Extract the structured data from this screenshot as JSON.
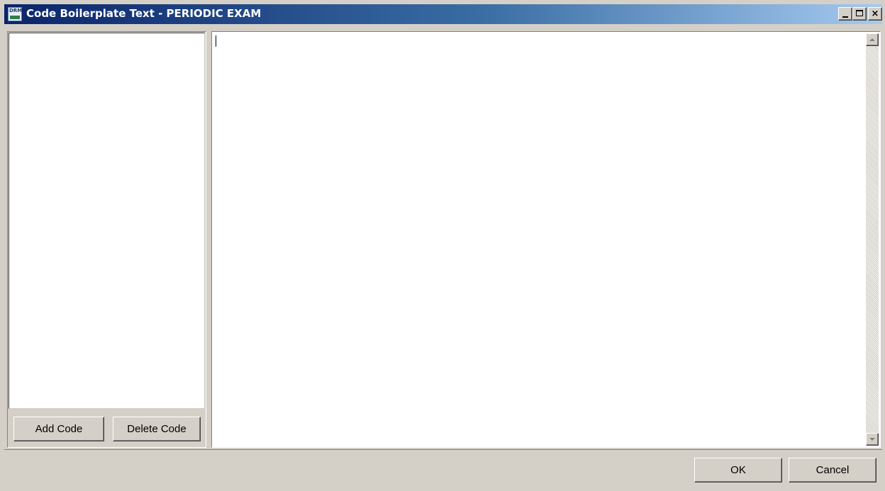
{
  "window": {
    "title": "Code Boilerplate Text - PERIODIC EXAM",
    "app_icon_text": "DRM",
    "caption_buttons": {
      "minimize": "minimize-icon",
      "maximize": "maximize-icon",
      "close": "×"
    }
  },
  "left_panel": {
    "codes": [],
    "add_button_label": "Add Code",
    "delete_button_label": "Delete Code"
  },
  "editor": {
    "text": ""
  },
  "footer": {
    "ok_label": "OK",
    "cancel_label": "Cancel"
  }
}
